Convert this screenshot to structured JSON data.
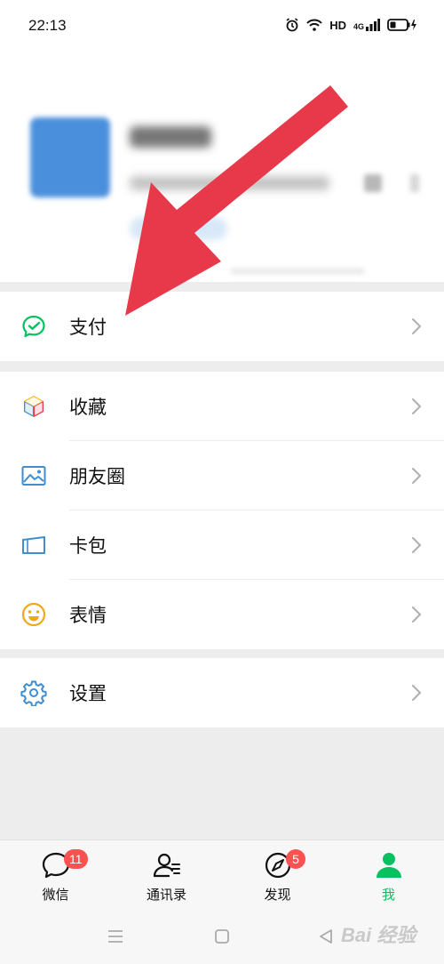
{
  "status_bar": {
    "time": "22:13",
    "hd": "HD",
    "net": "4G"
  },
  "menu": {
    "pay": {
      "label": "支付",
      "icon": "wechat-pay-icon"
    },
    "favorites": {
      "label": "收藏",
      "icon": "favorites-cube-icon"
    },
    "moments": {
      "label": "朋友圈",
      "icon": "moments-picture-icon"
    },
    "cards": {
      "label": "卡包",
      "icon": "card-wallet-icon"
    },
    "stickers": {
      "label": "表情",
      "icon": "smiley-icon"
    },
    "settings": {
      "label": "设置",
      "icon": "gear-icon"
    }
  },
  "tabs": [
    {
      "label": "微信",
      "badge": "11",
      "icon": "chat-bubble-icon"
    },
    {
      "label": "通讯录",
      "icon": "contacts-icon"
    },
    {
      "label": "发现",
      "badge": "5",
      "icon": "compass-icon"
    },
    {
      "label": "我",
      "icon": "person-icon",
      "active": true
    }
  ],
  "watermark": "Bai 经验",
  "colors": {
    "accent": "#07c160",
    "badge": "#fa5151",
    "arrow": "#e8394a"
  }
}
